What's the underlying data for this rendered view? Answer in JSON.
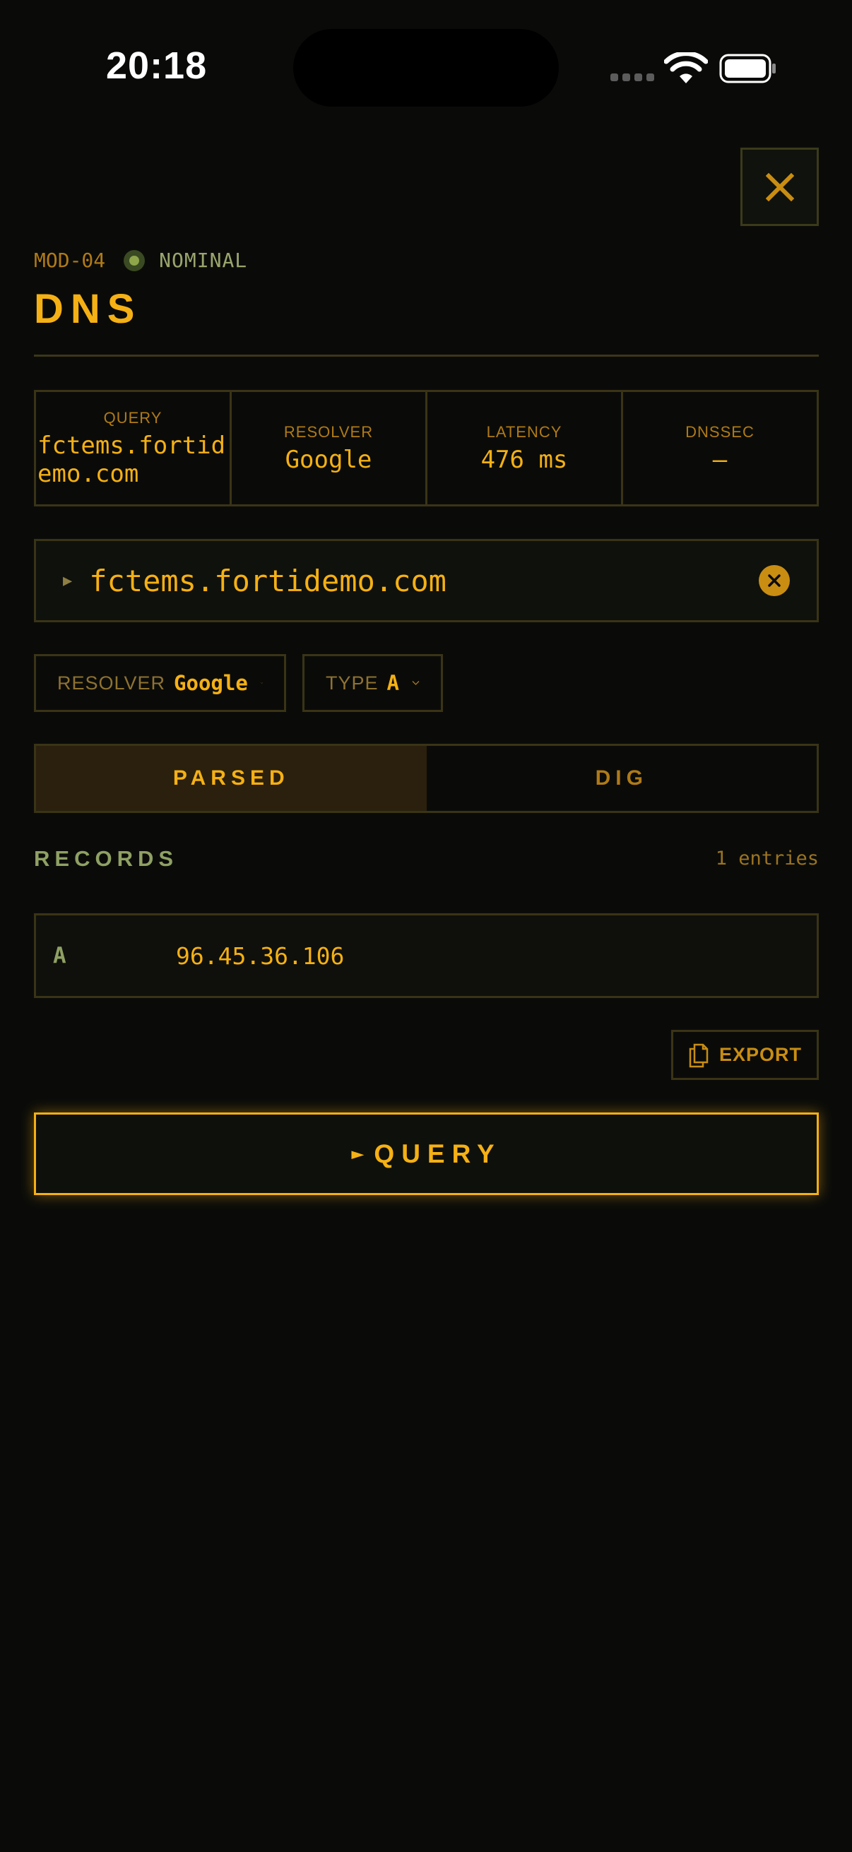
{
  "status_bar": {
    "time": "20:18"
  },
  "header": {
    "module_id": "MOD-04",
    "status": "NOMINAL",
    "title": "DNS"
  },
  "stats": [
    {
      "label": "QUERY",
      "value": "fctems.fortidemo.com"
    },
    {
      "label": "RESOLVER",
      "value": "Google"
    },
    {
      "label": "LATENCY",
      "value": "476 ms"
    },
    {
      "label": "DNSSEC",
      "value": "—"
    }
  ],
  "input": {
    "prompt_icon": "play-prompt-icon",
    "value": "fctems.fortidemo.com"
  },
  "filters": {
    "resolver_label": "RESOLVER",
    "resolver_value": "Google",
    "type_label": "TYPE",
    "type_value": "A"
  },
  "tabs": [
    {
      "label": "PARSED",
      "active": true
    },
    {
      "label": "DIG",
      "active": false
    }
  ],
  "records": {
    "title": "RECORDS",
    "count": "1 entries",
    "items": [
      {
        "type": "A",
        "value": "96.45.36.106"
      }
    ]
  },
  "actions": {
    "export_label": "EXPORT",
    "query_label": "QUERY"
  },
  "colors": {
    "accent": "#f5b014",
    "accent_dim": "#b07a17",
    "status_green": "#8fa64b",
    "background": "#0a0b09",
    "border": "#3a3416"
  }
}
